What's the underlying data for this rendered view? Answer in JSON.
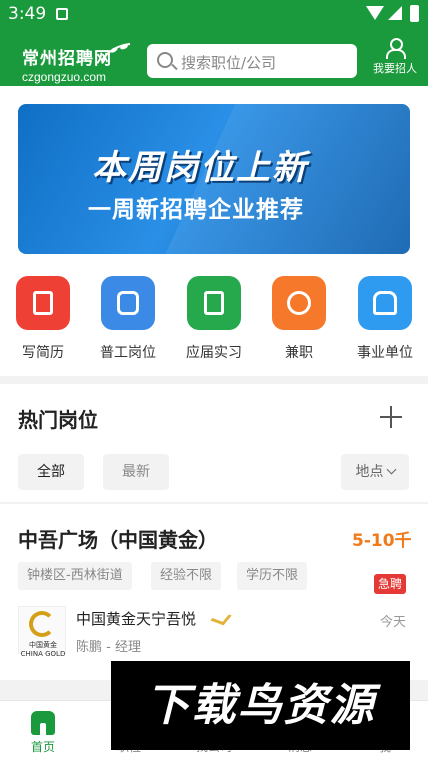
{
  "status_bar": {
    "time": "3:49"
  },
  "header": {
    "logo_cn": "常州招聘网",
    "logo_en": "czgongzuo.com",
    "search_placeholder": "搜索职位/公司",
    "recruit_label": "我要招人"
  },
  "banner": {
    "line1": "本周岗位上新",
    "line2": "一周新招聘企业推荐"
  },
  "categories": [
    {
      "label": "写简历",
      "icon": "resume-icon",
      "color": "#ee4035"
    },
    {
      "label": "普工岗位",
      "icon": "robot-icon",
      "color": "#3a8ae6"
    },
    {
      "label": "应届实习",
      "icon": "book-icon",
      "color": "#26a84c"
    },
    {
      "label": "兼职",
      "icon": "clock-icon",
      "color": "#f5782b"
    },
    {
      "label": "事业单位",
      "icon": "building-icon",
      "color": "#2e9bf0"
    }
  ],
  "hot_jobs": {
    "title": "热门岗位",
    "filters": {
      "all": "全部",
      "latest": "最新",
      "location": "地点"
    }
  },
  "job": {
    "title": "中吾广场（中国黄金）",
    "salary": "5-10千",
    "tags": [
      "钟楼区-西林街道",
      "经验不限",
      "学历不限"
    ],
    "urgent": "急聘",
    "company_logo_text": "中国黄金 CHINA GOLD",
    "company": "中国黄金天宁吾悦",
    "contact": "陈鹏 - 经理",
    "date": "今天"
  },
  "tabbar": [
    {
      "label": "首页",
      "icon": "home-icon"
    },
    {
      "label": "职位",
      "icon": "briefcase-icon"
    },
    {
      "label": "找公司",
      "icon": "company-icon"
    },
    {
      "label": "消息",
      "icon": "message-icon"
    },
    {
      "label": "我",
      "icon": "profile-icon"
    }
  ],
  "watermark": "下载鸟资源",
  "colors": {
    "brand_green": "#1a9a3c",
    "salary_orange": "#f07a1a",
    "urgent_red": "#e53935"
  }
}
